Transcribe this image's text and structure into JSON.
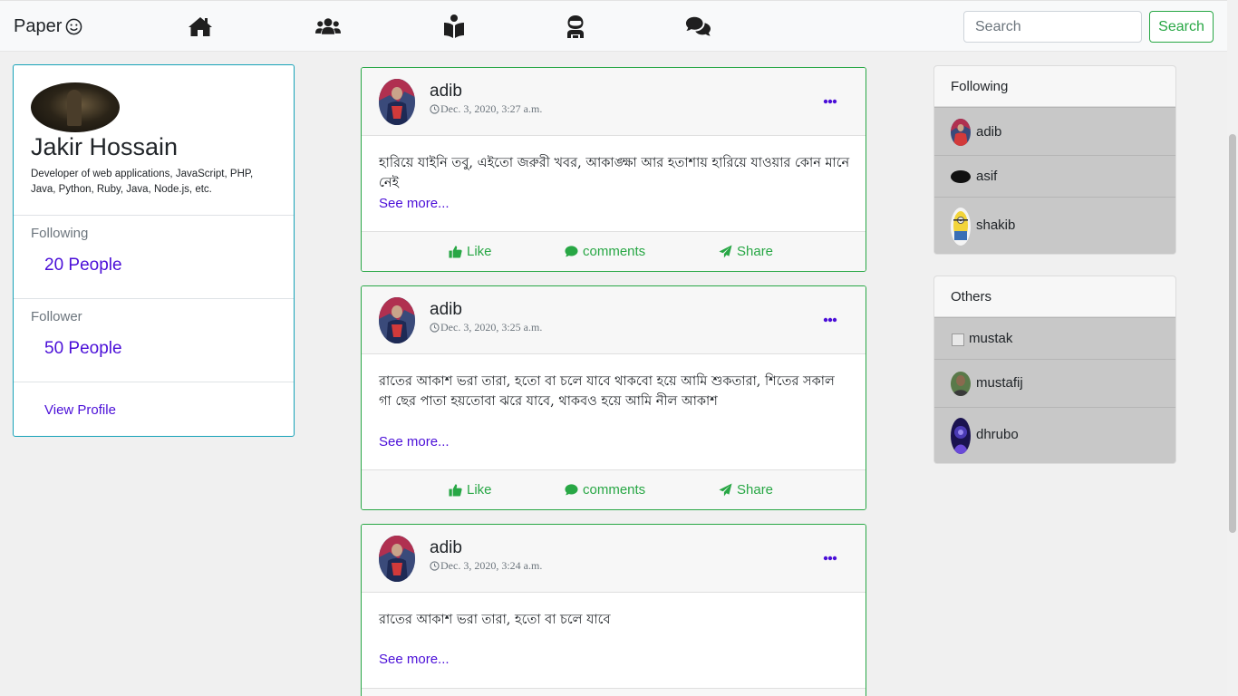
{
  "navbar": {
    "brand": "Paper",
    "brand_icon": "smile-icon",
    "nav_icons": [
      "home-icon",
      "users-icon",
      "book-reader-icon",
      "user-astronaut-icon",
      "comments-icon"
    ],
    "search_placeholder": "Search",
    "search_button": "Search"
  },
  "profile": {
    "name": "Jakir Hossain",
    "bio": "Developer of web applications, JavaScript, PHP, Java, Python, Ruby, Java, Node.js, etc.",
    "following_label": "Following",
    "following_value": "20 People",
    "follower_label": "Follower",
    "follower_value": "50 People",
    "view_profile": "View Profile"
  },
  "posts": [
    {
      "author": "adib",
      "time": "Dec. 3, 2020, 3:27 a.m.",
      "body": "হারিয়ে যাইনি তবু, এইতো জরুরী খবর, আকাঙ্ক্ষা আর হতাশায় হারিয়ে যাওয়ার কোন মানে নেই",
      "see_more": "See more...",
      "like": "Like",
      "comments": "comments",
      "share": "Share"
    },
    {
      "author": "adib",
      "time": "Dec. 3, 2020, 3:25 a.m.",
      "body": "রাতের আকাশ ভরা তারা, হতো বা চলে যাবে থাকবো হয়ে আমি শুকতারা, শিতের সকাল গা ছের পাতা হয়তোবা ঝরে যাবে, থাকবও হয়ে আমি নীল আকাশ",
      "see_more": "See more...",
      "like": "Like",
      "comments": "comments",
      "share": "Share"
    },
    {
      "author": "adib",
      "time": "Dec. 3, 2020, 3:24 a.m.",
      "body": "রাতের আকাশ ভরা তারা, হতো বা চলে যাবে",
      "see_more": "See more..."
    }
  ],
  "following_card": {
    "title": "Following",
    "items": [
      "adib",
      "asif",
      "shakib"
    ]
  },
  "others_card": {
    "title": "Others",
    "items": [
      "mustak",
      "mustafij",
      "dhrubo"
    ]
  },
  "colors": {
    "accent_green": "#28a745",
    "link_purple": "#4b0fd8",
    "profile_border": "#17a2b8"
  }
}
